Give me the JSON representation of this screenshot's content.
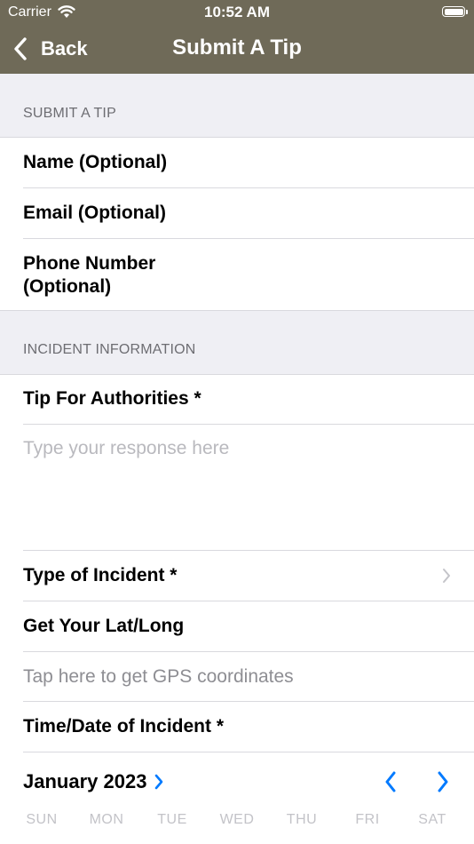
{
  "status_bar": {
    "carrier": "Carrier",
    "time": "10:52 AM"
  },
  "nav": {
    "back_label": "Back",
    "title": "Submit A Tip"
  },
  "sections": {
    "submit_header": "SUBMIT A TIP",
    "incident_header": "INCIDENT INFORMATION"
  },
  "fields": {
    "name": "Name (Optional)",
    "email": "Email (Optional)",
    "phone_line1": "Phone Number",
    "phone_line2": "(Optional)",
    "tip_label": "Tip For Authorities *",
    "tip_placeholder": "Type your response here",
    "incident_type": "Type of Incident *",
    "latlong": "Get Your Lat/Long",
    "gps_hint": "Tap here to get GPS coordinates",
    "time_date": "Time/Date of Incident *"
  },
  "calendar": {
    "month_year": "January 2023",
    "weekdays": [
      "SUN",
      "MON",
      "TUE",
      "WED",
      "THU",
      "FRI",
      "SAT"
    ]
  },
  "colors": {
    "nav_bar": "#6f6a58",
    "accent": "#007aff",
    "group_background": "#efeff4"
  }
}
